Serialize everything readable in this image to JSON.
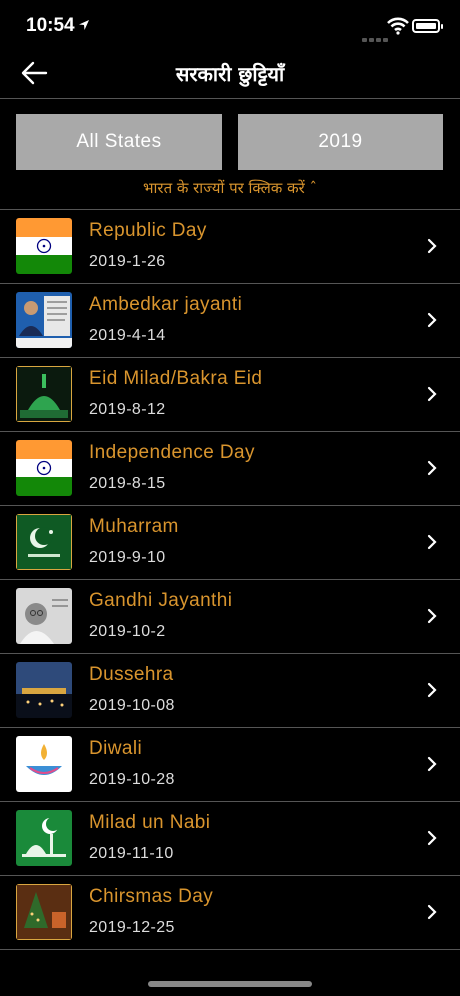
{
  "status": {
    "time": "10:54"
  },
  "nav": {
    "title": "सरकारी छुट्टियाँ"
  },
  "filters": {
    "states_label": "All States",
    "year_label": "2019"
  },
  "hint": "भारत के राज्यों पर क्लिक करें ˆ",
  "holidays": [
    {
      "title": "Republic Day",
      "date": "2019-1-26",
      "image": "india-flag"
    },
    {
      "title": "Ambedkar jayanti",
      "date": "2019-4-14",
      "image": "ambedkar-portrait"
    },
    {
      "title": "Eid Milad/Bakra Eid",
      "date": "2019-8-12",
      "image": "green-mosque"
    },
    {
      "title": "Independence Day",
      "date": "2019-8-15",
      "image": "india-flag"
    },
    {
      "title": "Muharram",
      "date": "2019-9-10",
      "image": "crescent-star"
    },
    {
      "title": "Gandhi Jayanthi",
      "date": "2019-10-2",
      "image": "gandhi-portrait"
    },
    {
      "title": "Dussehra",
      "date": "2019-10-08",
      "image": "night-festival"
    },
    {
      "title": "Diwali",
      "date": "2019-10-28",
      "image": "diya-lamp"
    },
    {
      "title": "Milad un Nabi",
      "date": "2019-11-10",
      "image": "mosque-moon"
    },
    {
      "title": "Chirsmas Day",
      "date": "2019-12-25",
      "image": "christmas-tree"
    }
  ],
  "colors": {
    "accent": "#d9952e",
    "button": "#a9a9a9",
    "background": "#000000"
  }
}
